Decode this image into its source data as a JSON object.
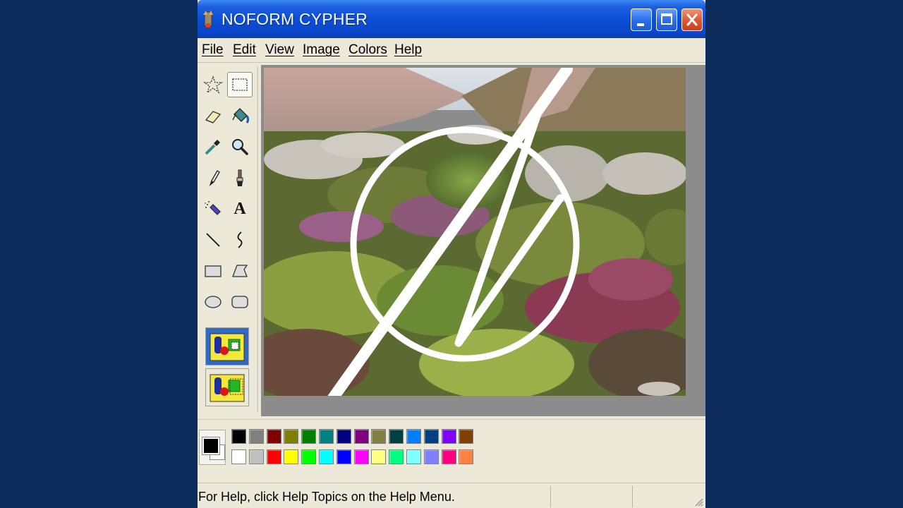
{
  "window": {
    "title": "NOFORM CYPHER",
    "controls": [
      "minimize",
      "maximize",
      "close"
    ]
  },
  "menu": {
    "items": [
      {
        "label": "File"
      },
      {
        "label": "Edit"
      },
      {
        "label": "View"
      },
      {
        "label": "Image"
      },
      {
        "label": "Colors"
      },
      {
        "label": "Help"
      }
    ]
  },
  "toolbox": {
    "tools": [
      {
        "name": "free-form-select",
        "icon": "star-select-icon"
      },
      {
        "name": "rectangle-select",
        "icon": "rect-select-icon",
        "selected": true
      },
      {
        "name": "eraser",
        "icon": "eraser-icon"
      },
      {
        "name": "fill-with-color",
        "icon": "paint-bucket-icon"
      },
      {
        "name": "pick-color",
        "icon": "eyedropper-icon"
      },
      {
        "name": "magnifier",
        "icon": "magnifier-icon"
      },
      {
        "name": "pencil",
        "icon": "pencil-icon"
      },
      {
        "name": "brush",
        "icon": "brush-icon"
      },
      {
        "name": "airbrush",
        "icon": "airbrush-icon"
      },
      {
        "name": "text",
        "icon": "text-icon",
        "glyph": "A"
      },
      {
        "name": "line",
        "icon": "line-icon"
      },
      {
        "name": "curve",
        "icon": "curve-icon"
      },
      {
        "name": "rectangle",
        "icon": "rectangle-icon"
      },
      {
        "name": "polygon",
        "icon": "polygon-icon"
      },
      {
        "name": "ellipse",
        "icon": "ellipse-icon"
      },
      {
        "name": "rounded-rectangle",
        "icon": "rounded-rect-icon"
      }
    ],
    "options": [
      {
        "name": "opaque-selection",
        "selected": true
      },
      {
        "name": "transparent-selection",
        "selected": false
      }
    ]
  },
  "canvas": {
    "content": "photo of rocky hillside with heather, overlaid with a white circle and slash mark"
  },
  "palette": {
    "foreground": "#000000",
    "background": "#ffffff",
    "row1": [
      "#000000",
      "#808080",
      "#800000",
      "#808000",
      "#008000",
      "#008080",
      "#000080",
      "#800080",
      "#808040",
      "#004040",
      "#0080ff",
      "#004080",
      "#8000ff",
      "#804000"
    ],
    "row2": [
      "#ffffff",
      "#c0c0c0",
      "#ff0000",
      "#ffff00",
      "#00ff00",
      "#00ffff",
      "#0000ff",
      "#ff00ff",
      "#ffff80",
      "#00ff80",
      "#80ffff",
      "#8080ff",
      "#ff0080",
      "#ff8040"
    ]
  },
  "status": {
    "text": "For Help, click Help Topics on the Help Menu."
  },
  "colors": {
    "desktop": "#0c2a5a",
    "titlebar": "#0a4fd8",
    "chrome": "#ece9d8",
    "workspace": "#8c8c8c"
  }
}
